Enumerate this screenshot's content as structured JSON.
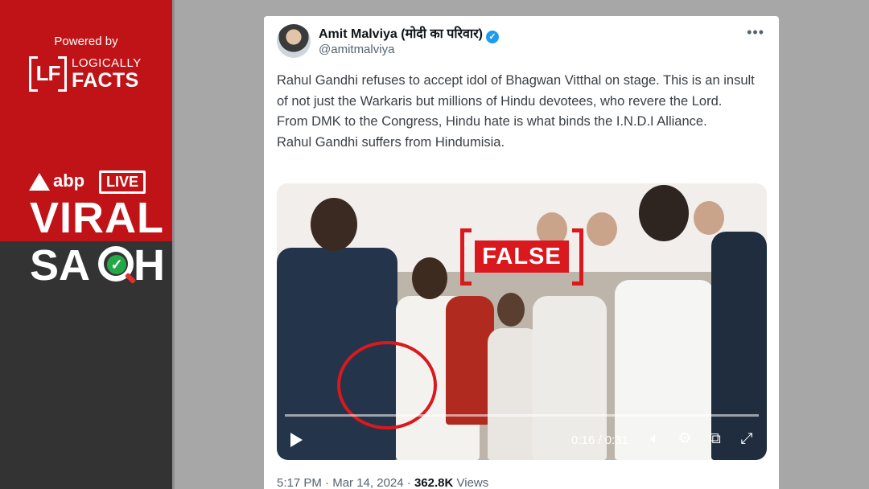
{
  "branding": {
    "powered_by": "Powered by",
    "lf_mark": "LF",
    "lf_word1": "LOGICALLY",
    "lf_word2": "FACTS",
    "abp": "abp",
    "live": "LIVE",
    "viral": "VIRAL",
    "sach_start": "SA",
    "sach_end": "H",
    "check_icon": "check-icon",
    "colors": {
      "red": "#c01317",
      "dark": "#333333",
      "check_green": "#22a846"
    }
  },
  "tweet": {
    "author_name": "Amit Malviya (मोदी का परिवार)",
    "handle": "@amitmalviya",
    "verified_icon": "verified-badge-icon",
    "more_label": "•••",
    "text": [
      "Rahul Gandhi refuses to accept idol of Bhagwan Vitthal on stage. This is an insult of not just the Warkaris but millions of Hindu devotees, who revere the Lord.",
      "From DMK to the Congress, Hindu hate is what binds the I.N.D.I Alliance.",
      "Rahul Gandhi suffers from Hindumisia."
    ],
    "time": "5:17 PM",
    "date": "Mar 14, 2024",
    "views_count": "362.8K",
    "views_label": "Views"
  },
  "video": {
    "stamp_label": "FALSE",
    "current_time": "0:16",
    "duration": "0:31",
    "timecode_sep": " / ",
    "progress": 0.52,
    "icons": [
      "play-icon",
      "volume-icon",
      "settings-icon",
      "pip-icon",
      "fullscreen-icon"
    ],
    "accent_red": "#d9191d"
  }
}
